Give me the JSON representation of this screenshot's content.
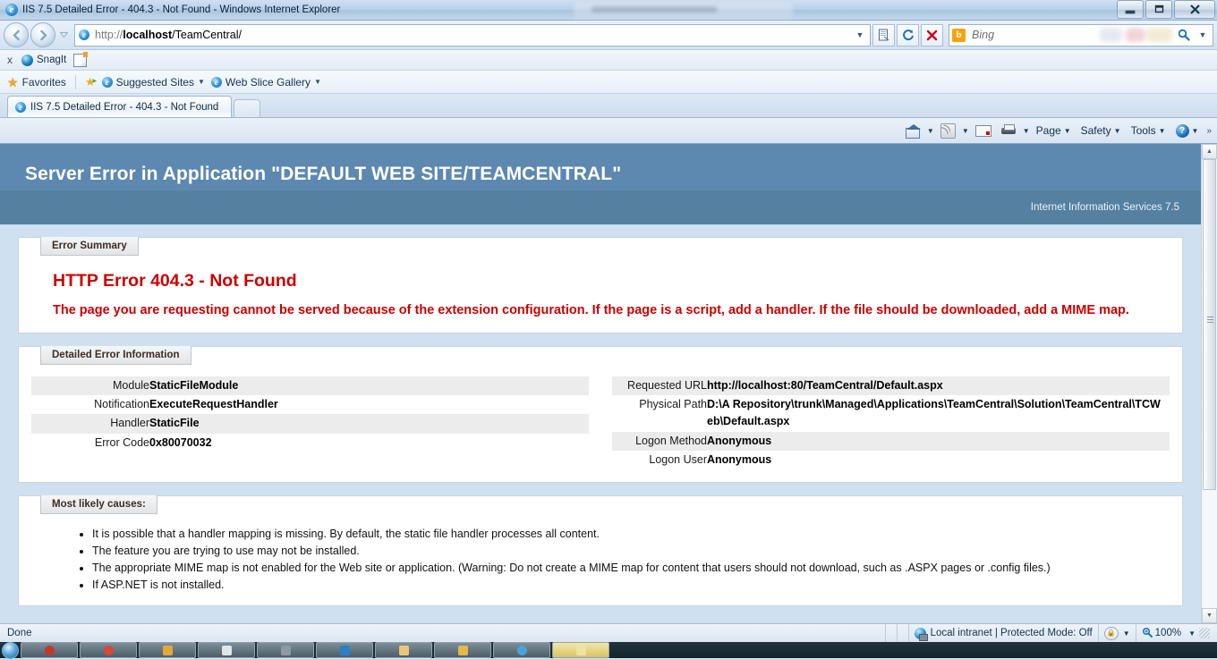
{
  "window": {
    "title": "IIS 7.5 Detailed Error - 404.3 - Not Found - Windows Internet Explorer",
    "minimize_label": "Minimize",
    "restore_label": "Restore Down",
    "close_label": "Close"
  },
  "nav": {
    "back_label": "Back",
    "forward_label": "Forward",
    "recent_pages_label": "Recent Pages",
    "address_url_prefix": "http://",
    "address_url_host": "localhost",
    "address_url_path": "/TeamCentral/",
    "address_full": "http://localhost/TeamCentral/",
    "compat_view_label": "Compatibility View",
    "refresh_label": "Refresh",
    "stop_label": "Stop",
    "search_provider": "Bing",
    "search_value": "",
    "search_placeholder": "Bing"
  },
  "snagit_bar": {
    "close_label": "x",
    "items": [
      {
        "label": "SnagIt",
        "icon": "snagit-orb-icon"
      },
      {
        "label": "",
        "icon": "snagit-capture-icon"
      }
    ]
  },
  "favorites_bar": {
    "favorites_label": "Favorites",
    "items": [
      {
        "label": "Suggested Sites",
        "icon": "ie-icon",
        "has_caret": true
      },
      {
        "label": "Web Slice Gallery",
        "icon": "web-slice-icon",
        "has_caret": true
      }
    ]
  },
  "tabs": {
    "items": [
      {
        "label": "IIS 7.5 Detailed Error - 404.3 - Not Found",
        "active": true
      }
    ],
    "new_tab_label": ""
  },
  "command_bar": {
    "home_label": "Home",
    "feeds_label": "Feeds",
    "mail_label": "Read Mail",
    "print_label": "Print",
    "menus": [
      {
        "label": "Page"
      },
      {
        "label": "Safety"
      },
      {
        "label": "Tools"
      }
    ],
    "help_label": "?",
    "overflow_label": "»"
  },
  "error_page": {
    "header_title": "Server Error in Application \"DEFAULT WEB SITE/TEAMCENTRAL\"",
    "header_subtitle": "Internet Information Services 7.5",
    "summary": {
      "tab_label": "Error Summary",
      "title": "HTTP Error 404.3 - Not Found",
      "description": "The page you are requesting cannot be served because of the extension configuration. If the page is a script, add a handler. If the file should be downloaded, add a MIME map."
    },
    "details": {
      "tab_label": "Detailed Error Information",
      "left_rows": [
        {
          "label": "Module",
          "value": "StaticFileModule"
        },
        {
          "label": "Notification",
          "value": "ExecuteRequestHandler"
        },
        {
          "label": "Handler",
          "value": "StaticFile"
        },
        {
          "label": "Error Code",
          "value": "0x80070032"
        }
      ],
      "right_rows": [
        {
          "label": "Requested URL",
          "value": "http://localhost:80/TeamCentral/Default.aspx"
        },
        {
          "label": "Physical Path",
          "value": "D:\\A Repository\\trunk\\Managed\\Applications\\TeamCentral\\Solution\\TeamCentral\\TCWeb\\Default.aspx"
        },
        {
          "label": "Logon Method",
          "value": "Anonymous"
        },
        {
          "label": "Logon User",
          "value": "Anonymous"
        }
      ]
    },
    "causes": {
      "tab_label": "Most likely causes:",
      "items": [
        "It is possible that a handler mapping is missing. By default, the static file handler processes all content.",
        "The feature you are trying to use may not be installed.",
        "The appropriate MIME map is not enabled for the Web site or application. (Warning: Do not create a MIME map for content that users should not download, such as .ASPX pages or .config files.)",
        "If ASP.NET is not installed."
      ]
    }
  },
  "status_bar": {
    "status_text": "Done",
    "zone_text": "Local intranet | Protected Mode: Off",
    "zoom_level": "100%"
  },
  "colors": {
    "header_blue": "#5d88b0",
    "subheader_blue": "#55809f",
    "page_background": "#cfe0f0",
    "error_red": "#cc0000",
    "row_alt": "#ececec"
  }
}
